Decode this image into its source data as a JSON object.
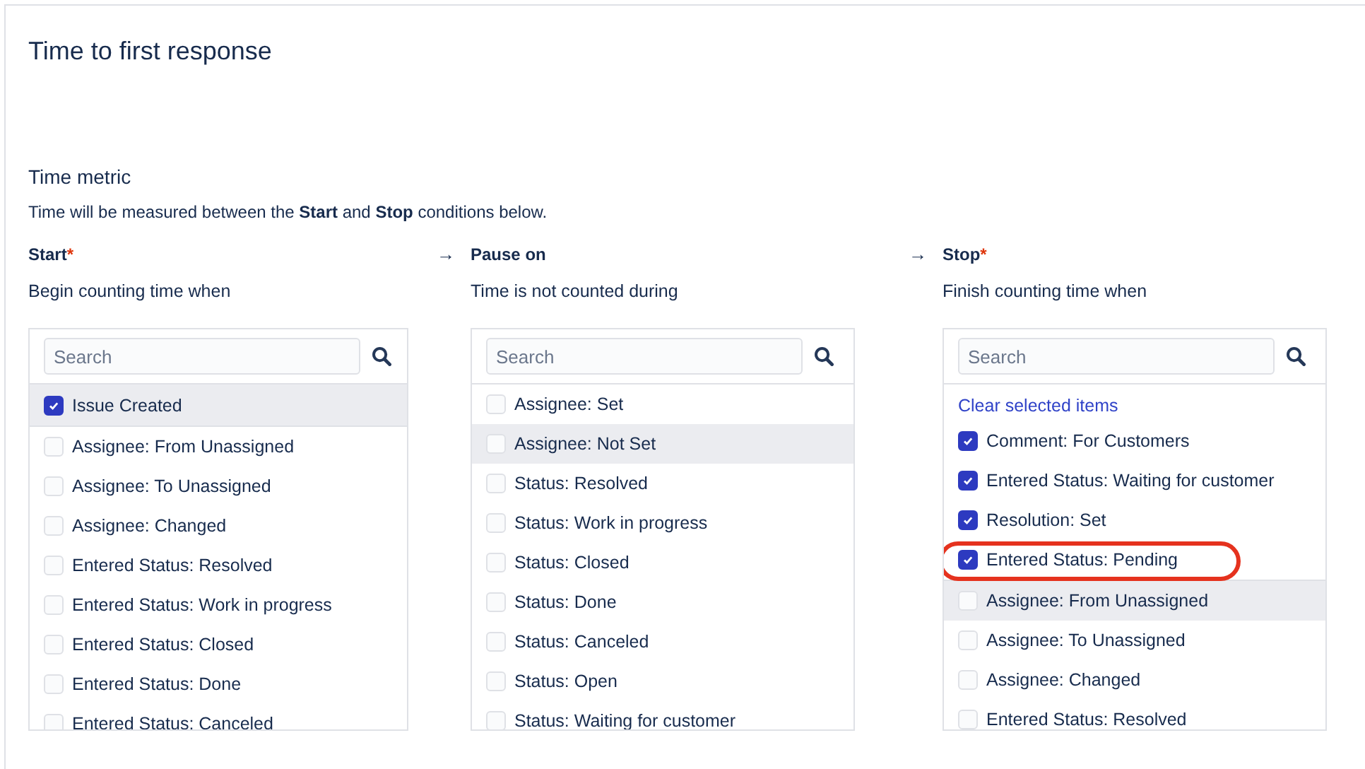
{
  "title": "Time to first response",
  "section": {
    "heading": "Time metric",
    "description": "Time will be measured between the **Start** and **Stop** conditions below."
  },
  "columns": [
    {
      "label": "Start",
      "required_mark": "*",
      "arrow_after": "→",
      "hint": "Begin counting time when",
      "search": {
        "placeholder": "Search"
      },
      "groups": [
        [
          {
            "label": "Issue Created",
            "checked": true,
            "highlighted": true,
            "circled": false
          }
        ],
        [
          {
            "label": "Assignee: From Unassigned",
            "checked": false,
            "highlighted": false,
            "circled": false
          },
          {
            "label": "Assignee: To Unassigned",
            "checked": false,
            "highlighted": false,
            "circled": false
          },
          {
            "label": "Assignee: Changed",
            "checked": false,
            "highlighted": false,
            "circled": false
          },
          {
            "label": "Entered Status: Resolved",
            "checked": false,
            "highlighted": false,
            "circled": false
          },
          {
            "label": "Entered Status: Work in progress",
            "checked": false,
            "highlighted": false,
            "circled": false
          },
          {
            "label": "Entered Status: Closed",
            "checked": false,
            "highlighted": false,
            "circled": false
          },
          {
            "label": "Entered Status: Done",
            "checked": false,
            "highlighted": false,
            "circled": false
          },
          {
            "label": "Entered Status: Canceled",
            "checked": false,
            "highlighted": false,
            "circled": false
          }
        ]
      ]
    },
    {
      "label": "Pause on",
      "arrow_after": "→",
      "hint": "Time is not counted during",
      "search": {
        "placeholder": "Search"
      },
      "groups": [
        [
          {
            "label": "Assignee: Set",
            "checked": false,
            "highlighted": false,
            "circled": false
          },
          {
            "label": "Assignee: Not Set",
            "checked": false,
            "highlighted": true,
            "circled": false
          },
          {
            "label": "Status: Resolved",
            "checked": false,
            "highlighted": false,
            "circled": false
          },
          {
            "label": "Status: Work in progress",
            "checked": false,
            "highlighted": false,
            "circled": false
          },
          {
            "label": "Status: Closed",
            "checked": false,
            "highlighted": false,
            "circled": false
          },
          {
            "label": "Status: Done",
            "checked": false,
            "highlighted": false,
            "circled": false
          },
          {
            "label": "Status: Canceled",
            "checked": false,
            "highlighted": false,
            "circled": false
          },
          {
            "label": "Status: Open",
            "checked": false,
            "highlighted": false,
            "circled": false
          },
          {
            "label": "Status: Waiting for customer",
            "checked": false,
            "highlighted": false,
            "circled": false
          }
        ]
      ]
    },
    {
      "label": "Stop",
      "required_mark": "*",
      "hint": "Finish counting time when",
      "search": {
        "placeholder": "Search"
      },
      "clear_link": "Clear selected items",
      "groups": [
        [
          {
            "label": "Comment: For Customers",
            "checked": true,
            "highlighted": false,
            "circled": false
          },
          {
            "label": "Entered Status: Waiting for customer",
            "checked": true,
            "highlighted": false,
            "circled": false
          },
          {
            "label": "Resolution: Set",
            "checked": true,
            "highlighted": false,
            "circled": false
          },
          {
            "label": "Entered Status: Pending",
            "checked": true,
            "highlighted": false,
            "circled": true
          }
        ],
        [
          {
            "label": "Assignee: From Unassigned",
            "checked": false,
            "highlighted": true,
            "circled": false
          },
          {
            "label": "Assignee: To Unassigned",
            "checked": false,
            "highlighted": false,
            "circled": false
          },
          {
            "label": "Assignee: Changed",
            "checked": false,
            "highlighted": false,
            "circled": false
          },
          {
            "label": "Entered Status: Resolved",
            "checked": false,
            "highlighted": false,
            "circled": false
          }
        ]
      ]
    }
  ]
}
